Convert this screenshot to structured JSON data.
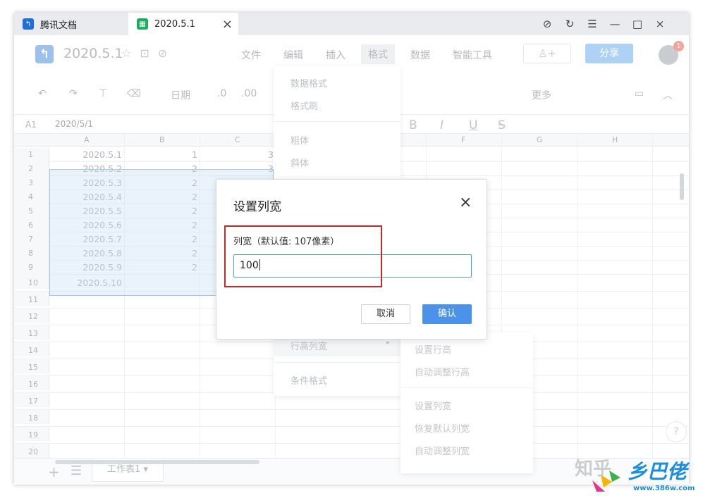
{
  "titlebar": {
    "tab1_label": "腾讯文档",
    "tab2_label": "2020.5.1",
    "tab_close": "×",
    "controls": [
      "⊘",
      "↻",
      "☰",
      "—",
      "□",
      "×"
    ]
  },
  "doc": {
    "title": "2020.5.1",
    "menus": [
      "文件",
      "编辑",
      "插入",
      "格式",
      "数据",
      "智能工具"
    ],
    "active_menu": "格式",
    "add_collaborator": "♙+",
    "share_label": "分享",
    "notif_count": "1"
  },
  "toolbar": {
    "date_label": "日期",
    "decimal_dec": ".0",
    "decimal_inc": ".00",
    "more_label": "更多",
    "bold": "B",
    "italic": "I",
    "underline": "U",
    "strike": "S"
  },
  "formula_bar": {
    "cell_ref": "A1",
    "content": "2020/5/1"
  },
  "grid": {
    "columns": [
      "A",
      "B",
      "C",
      "F",
      "G",
      "H"
    ],
    "rows": [
      {
        "num": "1",
        "a": "2020.5.1",
        "b": "1",
        "c": "3"
      },
      {
        "num": "2",
        "a": "2020.5.2",
        "b": "2",
        "c": "3"
      },
      {
        "num": "3",
        "a": "2020.5.3",
        "b": "2",
        "c": ""
      },
      {
        "num": "4",
        "a": "2020.5.4",
        "b": "2",
        "c": ""
      },
      {
        "num": "5",
        "a": "2020.5.5",
        "b": "2",
        "c": ""
      },
      {
        "num": "6",
        "a": "2020.5.6",
        "b": "2",
        "c": ""
      },
      {
        "num": "7",
        "a": "2020.5.7",
        "b": "2",
        "c": ""
      },
      {
        "num": "8",
        "a": "2020.5.8",
        "b": "2",
        "c": ""
      },
      {
        "num": "9",
        "a": "2020.5.9",
        "b": "2",
        "c": ""
      },
      {
        "num": "10",
        "a": "2020.5.10",
        "b": "",
        "c": ""
      },
      {
        "num": "11",
        "a": "",
        "b": "",
        "c": ""
      },
      {
        "num": "12",
        "a": "",
        "b": "",
        "c": ""
      },
      {
        "num": "13",
        "a": "",
        "b": "",
        "c": ""
      },
      {
        "num": "14",
        "a": "",
        "b": "",
        "c": ""
      },
      {
        "num": "15",
        "a": "",
        "b": "",
        "c": ""
      },
      {
        "num": "16",
        "a": "",
        "b": "",
        "c": ""
      },
      {
        "num": "17",
        "a": "",
        "b": "",
        "c": ""
      },
      {
        "num": "18",
        "a": "",
        "b": "",
        "c": ""
      },
      {
        "num": "19",
        "a": "",
        "b": "",
        "c": ""
      },
      {
        "num": "20",
        "a": "",
        "b": "",
        "c": ""
      }
    ]
  },
  "format_menu": {
    "items": [
      "数据格式",
      "格式刷",
      "粗体",
      "斜体",
      "行高列宽",
      "条件格式"
    ],
    "submenu_arrow": "▸"
  },
  "submenu": {
    "items": [
      "设置行高",
      "自动调整行高",
      "设置列宽",
      "恢复默认列宽",
      "自动调整列宽"
    ]
  },
  "sheetbar": {
    "add": "+",
    "list": "☰",
    "sheet_name": "工作表1 ▾"
  },
  "help": "?",
  "dialog": {
    "title": "设置列宽",
    "close": "×",
    "label": "列宽（默认值: 107像素）",
    "input_value": "100",
    "cancel_label": "取消",
    "ok_label": "确认"
  },
  "watermark": {
    "zhihu": "知乎",
    "logo": "乡巴佬",
    "url": "www.386w.com"
  },
  "colors": {
    "accent": "#4a92ea",
    "highlight_border": "#c0282a",
    "selection": "#a6c8ee"
  }
}
